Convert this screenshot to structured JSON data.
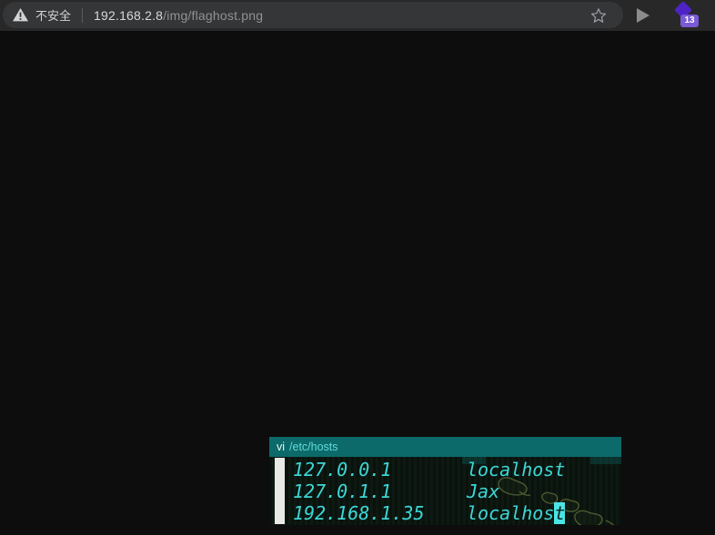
{
  "browser": {
    "security_chip": {
      "label": "不安全"
    },
    "url": {
      "host": "192.168.2.8",
      "path": "/img/flaghost.png"
    },
    "extension": {
      "badge_count": "13"
    }
  },
  "terminal": {
    "title_command": "vi",
    "title_file": "/etc/hosts",
    "rows": [
      {
        "address": "127.0.0.1",
        "hostname": "localhost"
      },
      {
        "address": "127.0.1.1",
        "hostname": "Jax"
      },
      {
        "address": "192.168.1.35",
        "hostname_pre_cursor": "localhos",
        "cursor_char": "t"
      }
    ]
  },
  "colors": {
    "toolbar_bg": "#282829",
    "omnibox_bg": "#353638",
    "page_bg": "#0d0d0e",
    "terminal_header_bg": "#0c6a6a",
    "terminal_text_cyan": "#3cd7d5",
    "cursor_bg": "#4be4e4",
    "gutter_white": "#e9e9e6",
    "extension_purple": "#4e23c6",
    "badge_purple": "#7a5ad6"
  }
}
